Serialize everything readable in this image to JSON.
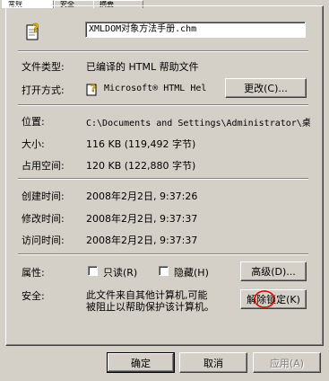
{
  "tabs": [
    {
      "label": "常规"
    },
    {
      "label": "安全"
    },
    {
      "label": "摘要"
    }
  ],
  "header": {
    "file_icon": "help-file-icon",
    "filename": "XMLDOM对象方法手册.chm"
  },
  "properties": {
    "type_label": "文件类型:",
    "type_value": "已编译的 HTML 帮助文件",
    "open_with_label": "打开方式:",
    "open_with_icon": "help-app-icon",
    "open_with_value": "Microsoft® HTML Hel",
    "change_button": "更改(C)...",
    "location_label": "位置:",
    "location_value": "C:\\Documents and Settings\\Administrator\\桌",
    "size_label": "大小:",
    "size_value": "116 KB (119,492 字节)",
    "disk_size_label": "占用空间:",
    "disk_size_value": "120 KB (122,880 字节)",
    "created_label": "创建时间:",
    "created_value": "2008年2月2日, 9:37:26",
    "modified_label": "修改时间:",
    "modified_value": "2008年2月2日, 9:37:37",
    "accessed_label": "访问时间:",
    "accessed_value": "2008年2月2日, 9:37:37"
  },
  "attributes": {
    "label": "属性:",
    "readonly_label": "只读(R)",
    "readonly_checked": false,
    "hidden_label": "隐藏(H)",
    "hidden_checked": false,
    "advanced_button": "高级(D)..."
  },
  "security": {
    "label": "安全:",
    "message_line1": "此文件来自其他计算机,可能",
    "message_line2": "被阻止以帮助保护该计算机。",
    "unblock_button": "解除锁定(K)"
  },
  "footer": {
    "ok_button": "确定",
    "cancel_button": "取消",
    "apply_button": "应用(A)"
  },
  "colors": {
    "dialog_bg": "#d4d0c8",
    "annotation_circle": "#e00000"
  }
}
